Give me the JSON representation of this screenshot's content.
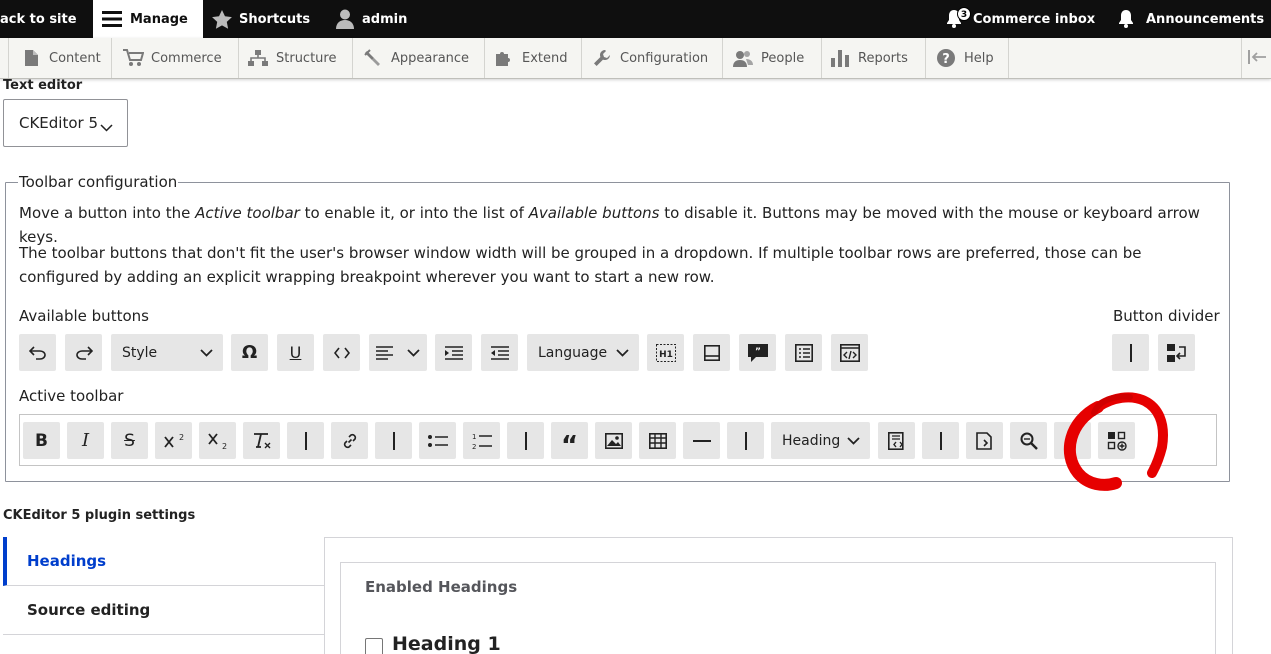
{
  "topbar": {
    "back": "ack to site",
    "manage": "Manage",
    "shortcuts": "Shortcuts",
    "user": "admin",
    "commerce_inbox": "Commerce inbox",
    "commerce_inbox_count": "3",
    "announcements": "Announcements"
  },
  "tray": {
    "items": [
      "Content",
      "Commerce",
      "Structure",
      "Appearance",
      "Extend",
      "Configuration",
      "People",
      "Reports",
      "Help"
    ]
  },
  "editor": {
    "label": "Text editor",
    "value": "CKEditor 5"
  },
  "toolbar_config": {
    "legend": "Toolbar configuration",
    "p1_a": "Move a button into the ",
    "p1_b": "Active toolbar",
    "p1_c": " to enable it, or into the list of ",
    "p1_d": "Available buttons",
    "p1_e": " to disable it. Buttons may be moved with the mouse or keyboard arrow keys.",
    "p2": "The toolbar buttons that don't fit the user's browser window width will be grouped in a dropdown. If multiple toolbar rows are preferred, those can be configured by adding an explicit wrapping breakpoint wherever you want to start a new row.",
    "available_label": "Available buttons",
    "divider_label": "Button divider",
    "active_label": "Active toolbar",
    "style_dropdown": "Style",
    "language_dropdown": "Language",
    "heading_dropdown": "Heading"
  },
  "plugin_settings": {
    "title": "CKEditor 5 plugin settings",
    "tabs": [
      "Headings",
      "Source editing"
    ],
    "panel_title": "Enabled Headings",
    "heading1_label": "Heading 1"
  }
}
